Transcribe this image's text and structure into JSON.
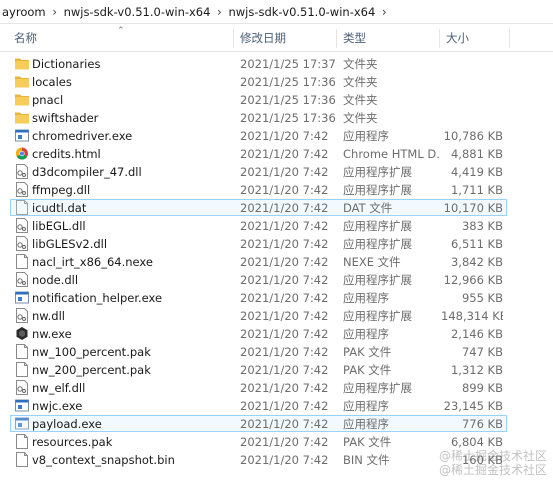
{
  "breadcrumb": [
    "ayroom",
    "nwjs-sdk-v0.51.0-win-x64",
    "nwjs-sdk-v0.51.0-win-x64"
  ],
  "columns": {
    "name": "名称",
    "modified": "修改日期",
    "type": "类型",
    "size": "大小"
  },
  "files": [
    {
      "name": "Dictionaries",
      "modified": "2021/1/25 17:37",
      "type": "文件夹",
      "size": "",
      "icon": "folder-icon"
    },
    {
      "name": "locales",
      "modified": "2021/1/25 17:36",
      "type": "文件夹",
      "size": "",
      "icon": "folder-icon"
    },
    {
      "name": "pnacl",
      "modified": "2021/1/25 17:36",
      "type": "文件夹",
      "size": "",
      "icon": "folder-icon"
    },
    {
      "name": "swiftshader",
      "modified": "2021/1/25 17:36",
      "type": "文件夹",
      "size": "",
      "icon": "folder-icon"
    },
    {
      "name": "chromedriver.exe",
      "modified": "2021/1/20 7:42",
      "type": "应用程序",
      "size": "10,786 KB",
      "icon": "exe-icon"
    },
    {
      "name": "credits.html",
      "modified": "2021/1/20 7:42",
      "type": "Chrome HTML D...",
      "size": "4,881 KB",
      "icon": "chrome-icon"
    },
    {
      "name": "d3dcompiler_47.dll",
      "modified": "2021/1/20 7:42",
      "type": "应用程序扩展",
      "size": "4,419 KB",
      "icon": "dll-icon"
    },
    {
      "name": "ffmpeg.dll",
      "modified": "2021/1/20 7:42",
      "type": "应用程序扩展",
      "size": "1,711 KB",
      "icon": "dll-icon"
    },
    {
      "name": "icudtl.dat",
      "modified": "2021/1/20 7:42",
      "type": "DAT 文件",
      "size": "10,170 KB",
      "icon": "file-icon",
      "selected": true
    },
    {
      "name": "libEGL.dll",
      "modified": "2021/1/20 7:42",
      "type": "应用程序扩展",
      "size": "383 KB",
      "icon": "dll-icon"
    },
    {
      "name": "libGLESv2.dll",
      "modified": "2021/1/20 7:42",
      "type": "应用程序扩展",
      "size": "6,511 KB",
      "icon": "dll-icon"
    },
    {
      "name": "nacl_irt_x86_64.nexe",
      "modified": "2021/1/20 7:42",
      "type": "NEXE 文件",
      "size": "3,842 KB",
      "icon": "file-icon"
    },
    {
      "name": "node.dll",
      "modified": "2021/1/20 7:42",
      "type": "应用程序扩展",
      "size": "12,966 KB",
      "icon": "dll-icon"
    },
    {
      "name": "notification_helper.exe",
      "modified": "2021/1/20 7:42",
      "type": "应用程序",
      "size": "955 KB",
      "icon": "exe-icon"
    },
    {
      "name": "nw.dll",
      "modified": "2021/1/20 7:42",
      "type": "应用程序扩展",
      "size": "148,314 KB",
      "icon": "dll-icon"
    },
    {
      "name": "nw.exe",
      "modified": "2021/1/20 7:42",
      "type": "应用程序",
      "size": "2,146 KB",
      "icon": "nw-icon"
    },
    {
      "name": "nw_100_percent.pak",
      "modified": "2021/1/20 7:42",
      "type": "PAK 文件",
      "size": "747 KB",
      "icon": "file-icon"
    },
    {
      "name": "nw_200_percent.pak",
      "modified": "2021/1/20 7:42",
      "type": "PAK 文件",
      "size": "1,312 KB",
      "icon": "file-icon"
    },
    {
      "name": "nw_elf.dll",
      "modified": "2021/1/20 7:42",
      "type": "应用程序扩展",
      "size": "899 KB",
      "icon": "dll-icon"
    },
    {
      "name": "nwjc.exe",
      "modified": "2021/1/20 7:42",
      "type": "应用程序",
      "size": "23,145 KB",
      "icon": "exe-icon"
    },
    {
      "name": "payload.exe",
      "modified": "2021/1/20 7:42",
      "type": "应用程序",
      "size": "776 KB",
      "icon": "exe-icon",
      "selected": true
    },
    {
      "name": "resources.pak",
      "modified": "2021/1/20 7:42",
      "type": "PAK 文件",
      "size": "6,804 KB",
      "icon": "file-icon"
    },
    {
      "name": "v8_context_snapshot.bin",
      "modified": "2021/1/20 7:42",
      "type": "BIN 文件",
      "size": "160 KB",
      "icon": "file-icon"
    }
  ],
  "watermark": [
    "@稀土掘金技术社区",
    "@稀土掘金技术社区"
  ],
  "colors": {
    "folder": "#f3c44a",
    "selection_border": "#99d1ff",
    "header_text": "#4c607a"
  }
}
